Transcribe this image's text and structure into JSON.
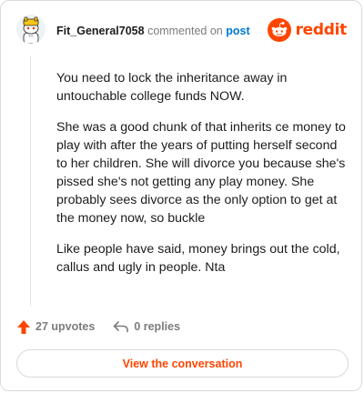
{
  "comment": {
    "username": "Fit_General7058",
    "action_text": " commented on ",
    "post_link_text": "post",
    "paragraphs": [
      "You need to lock the inheritance away in untouchable college funds NOW.",
      "She was a good chunk of that inherits ce money to play with after the years of putting herself second to her children. She will divorce you because she's pissed she's not getting any play money. She probably sees divorce as the only option to get at the money now, so buckle",
      "Like people have said, money brings out the cold, callus and ugly in people. Nta"
    ]
  },
  "brand": {
    "logo_text": "reddit",
    "icon": "reddit-snoo-icon",
    "color": "#ff4500"
  },
  "footer": {
    "upvotes_label": "27 upvotes",
    "upvote_icon": "upvote-arrow-icon",
    "upvote_color": "#ff4500",
    "replies_label": "0 replies",
    "reply_icon": "reply-arrow-icon"
  },
  "cta": {
    "label": "View the conversation"
  }
}
